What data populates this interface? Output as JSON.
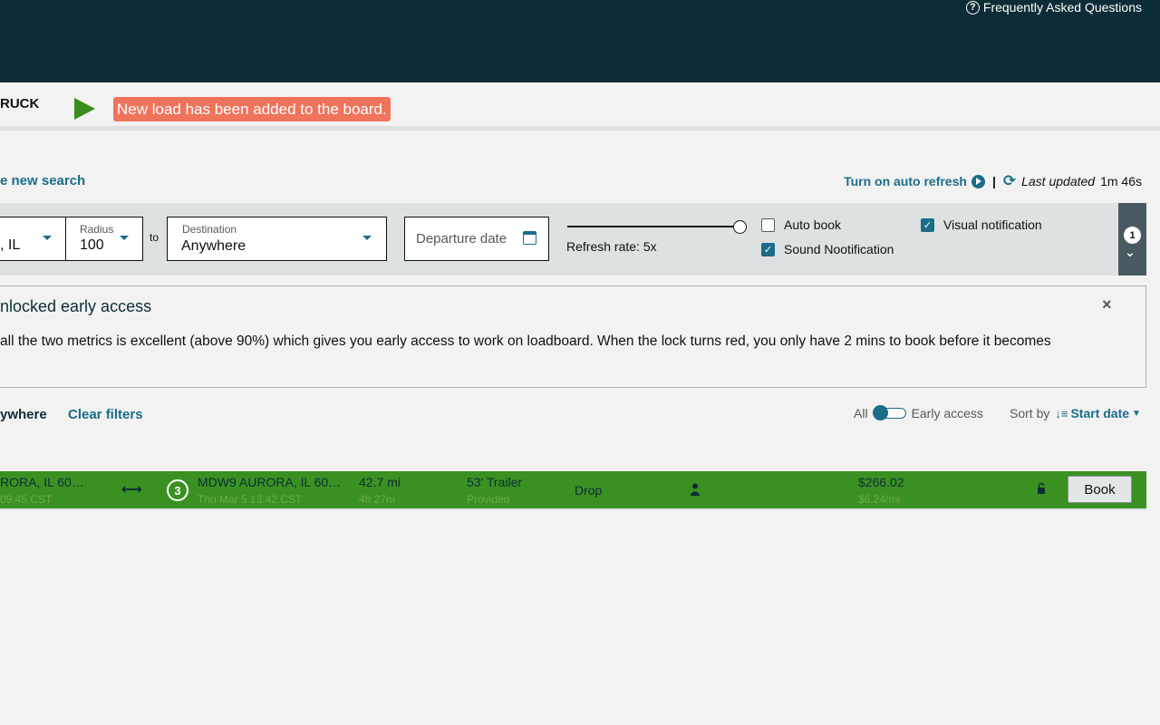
{
  "header": {
    "faq_label": "Frequently Asked Questions",
    "faq_icon": "?"
  },
  "notification": {
    "truck_label": "RUCK",
    "toast": "New load has been added to the board."
  },
  "search_bar": {
    "new_search": "e new search",
    "auto_refresh": "Turn on auto refresh",
    "separator": "|",
    "last_updated_label": "Last updated",
    "last_updated_value": "1m 46s"
  },
  "filters": {
    "origin_value": ", IL",
    "radius_label": "Radius",
    "radius_value": "100",
    "to_label": "to",
    "destination_label": "Destination",
    "destination_value": "Anywhere",
    "departure_placeholder": "Departure date",
    "refresh_rate": "Refresh rate: 5x",
    "refresh_rate_level": 1.0,
    "auto_book": {
      "label": "Auto book",
      "checked": false
    },
    "sound_notification": {
      "label": "Sound Nootification",
      "checked": true
    },
    "visual_notification": {
      "label": "Visual notification",
      "checked": true
    },
    "side_badge": "1"
  },
  "banner": {
    "title": "nlocked early access",
    "text": "all the two metrics is excellent (above 90%) which gives you early access to work on loadboard. When the lock turns red, you only have 2 mins to book before it becomes",
    "close": "×"
  },
  "results_bar": {
    "filter_chip": "ywhere",
    "clear_filters": "Clear filters",
    "toggle_left": "All",
    "toggle_right": "Early access",
    "sort_label": "Sort by",
    "sort_value": "Start date"
  },
  "load": {
    "origin": "RORA, IL 60…",
    "origin_time": "09:45 CST",
    "stops": "3",
    "destination": "MDW9 AURORA, IL 60…",
    "destination_time": "Thu Mar 5 13:42 CST",
    "distance": "42.7 mi",
    "duration": "4h 27m",
    "equipment": "53' Trailer",
    "equipment_sub": "Provided",
    "type": "Drop",
    "price": "$266.02",
    "rate": "$6.24/mi",
    "book_label": "Book",
    "row_color": "#3a9122"
  },
  "colors": {
    "header_bg": "#0d2d36",
    "accent": "#1b6d88",
    "toast_bg": "#f0735c"
  }
}
